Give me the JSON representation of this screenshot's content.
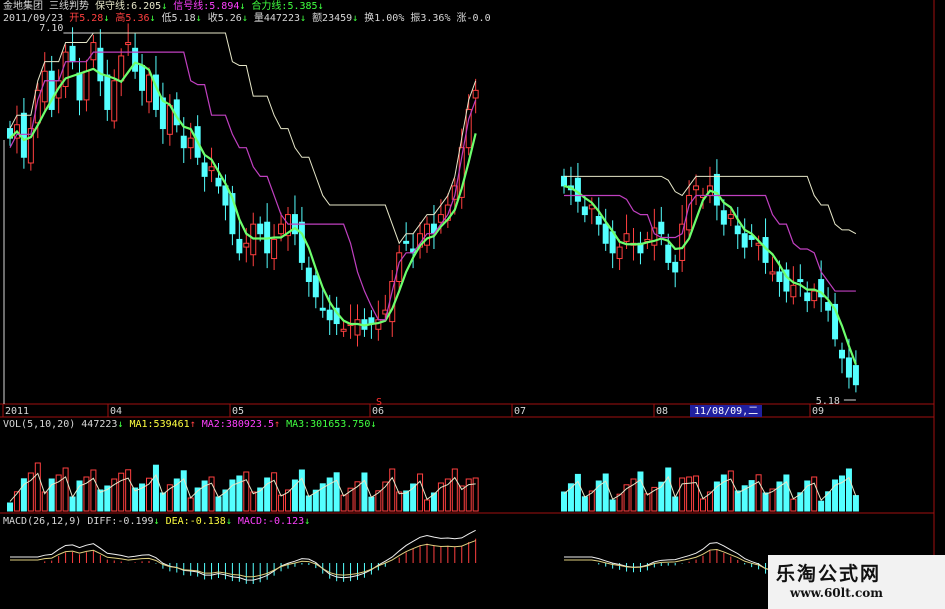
{
  "colors": {
    "background": "#000000",
    "up_candle": "#ff4040",
    "down_candle": "#54ffff",
    "ma_green": "#6dff6d",
    "ma_white": "#e6e6c8",
    "ma_magenta": "#c040c0",
    "frame": "#a01010",
    "text_white": "#d8d8d8",
    "text_magenta": "#ff40ff",
    "text_yellow": "#ffff40",
    "text_green": "#40ff40"
  },
  "header": {
    "line1": {
      "stock": "金地集团",
      "indicator": "三线判势",
      "baoshou": "保守线:6.205",
      "xinhao": "信号线:5.894",
      "heli": "合力线:5.385",
      "arrow_down": "↓"
    },
    "line2": {
      "date": "2011/09/23",
      "open": "开5.28",
      "high": "高5.36",
      "low": "低5.18",
      "close": "收5.26",
      "volume": "量447223",
      "amount": "额23459",
      "turnover": "换1.00%",
      "amplitude": "振3.36%",
      "change": "涨-0.0"
    }
  },
  "price_labels": {
    "max": "7.10",
    "min": "5.18"
  },
  "x_axis": {
    "labels": [
      "2011",
      "04",
      "05",
      "06",
      "07",
      "08",
      "09"
    ],
    "cursor_date": "11/08/09,二",
    "marker": "S"
  },
  "volume_header": {
    "title": "VOL(5,10,20)",
    "vol": "447223",
    "ma1": "MA1:539461",
    "ma2": "MA2:380923.5",
    "ma3": "MA3:301653.750"
  },
  "macd_header": {
    "title": "MACD(26,12,9)",
    "diff": "DIFF:-0.199",
    "dea": "DEA:-0.138",
    "macd": "MACD:-0.123"
  },
  "watermark": {
    "name": "乐淘公式网",
    "url": "www.60lt.com"
  },
  "chart_data": [
    {
      "type": "candlestick",
      "title": "三线判势",
      "y_range_seen": [
        5.18,
        7.1
      ],
      "x_labels": [
        "2011",
        "04",
        "05",
        "06",
        "07",
        "08",
        "09"
      ],
      "segment1_close": [
        6.55,
        6.62,
        6.45,
        6.6,
        6.8,
        6.9,
        6.7,
        6.85,
        7.0,
        6.95,
        6.75,
        6.9,
        7.05,
        6.85,
        6.7,
        6.85,
        6.98,
        7.05,
        6.9,
        6.8,
        6.88,
        6.7,
        6.6,
        6.72,
        6.62,
        6.5,
        6.55,
        6.45,
        6.35,
        6.4,
        6.3,
        6.2,
        6.05,
        5.95,
        6.0,
        6.1,
        6.05,
        5.95,
        6.02,
        6.1,
        6.15,
        6.05,
        5.9,
        5.8,
        5.72,
        5.65,
        5.6,
        5.58,
        5.55,
        5.58,
        5.6,
        5.55,
        5.58,
        5.6,
        5.65,
        5.8,
        5.95,
        6.0,
        5.95,
        6.05,
        6.1,
        6.05,
        6.15,
        6.2,
        6.3,
        6.5,
        6.7,
        6.8
      ],
      "segment2_close": [
        6.3,
        6.28,
        6.22,
        6.15,
        6.2,
        6.1,
        6.0,
        5.95,
        5.98,
        6.05,
        6.0,
        5.95,
        6.02,
        6.08,
        6.05,
        5.9,
        5.85,
        6.1,
        6.25,
        6.3,
        6.25,
        6.3,
        6.2,
        6.1,
        6.15,
        6.05,
        5.98,
        6.02,
        6.0,
        5.9,
        5.85,
        5.8,
        5.75,
        5.78,
        5.8,
        5.7,
        5.75,
        5.72,
        5.65,
        5.5,
        5.4,
        5.3,
        5.26
      ],
      "lines": [
        "保守线",
        "信号线",
        "合力线"
      ],
      "last": {
        "保守线": 6.205,
        "信号线": 5.894,
        "合力线": 5.385
      }
    },
    {
      "type": "bar",
      "title": "VOL(5,10,20)",
      "series": [
        {
          "name": "VOL",
          "last": 447223
        },
        {
          "name": "MA1",
          "last": 539461
        },
        {
          "name": "MA2",
          "last": 380923.5
        },
        {
          "name": "MA3",
          "last": 301653.75
        }
      ]
    },
    {
      "type": "bar",
      "title": "MACD(26,12,9)",
      "series": [
        {
          "name": "DIFF",
          "last": -0.199
        },
        {
          "name": "DEA",
          "last": -0.138
        },
        {
          "name": "MACD",
          "last": -0.123
        }
      ]
    }
  ]
}
